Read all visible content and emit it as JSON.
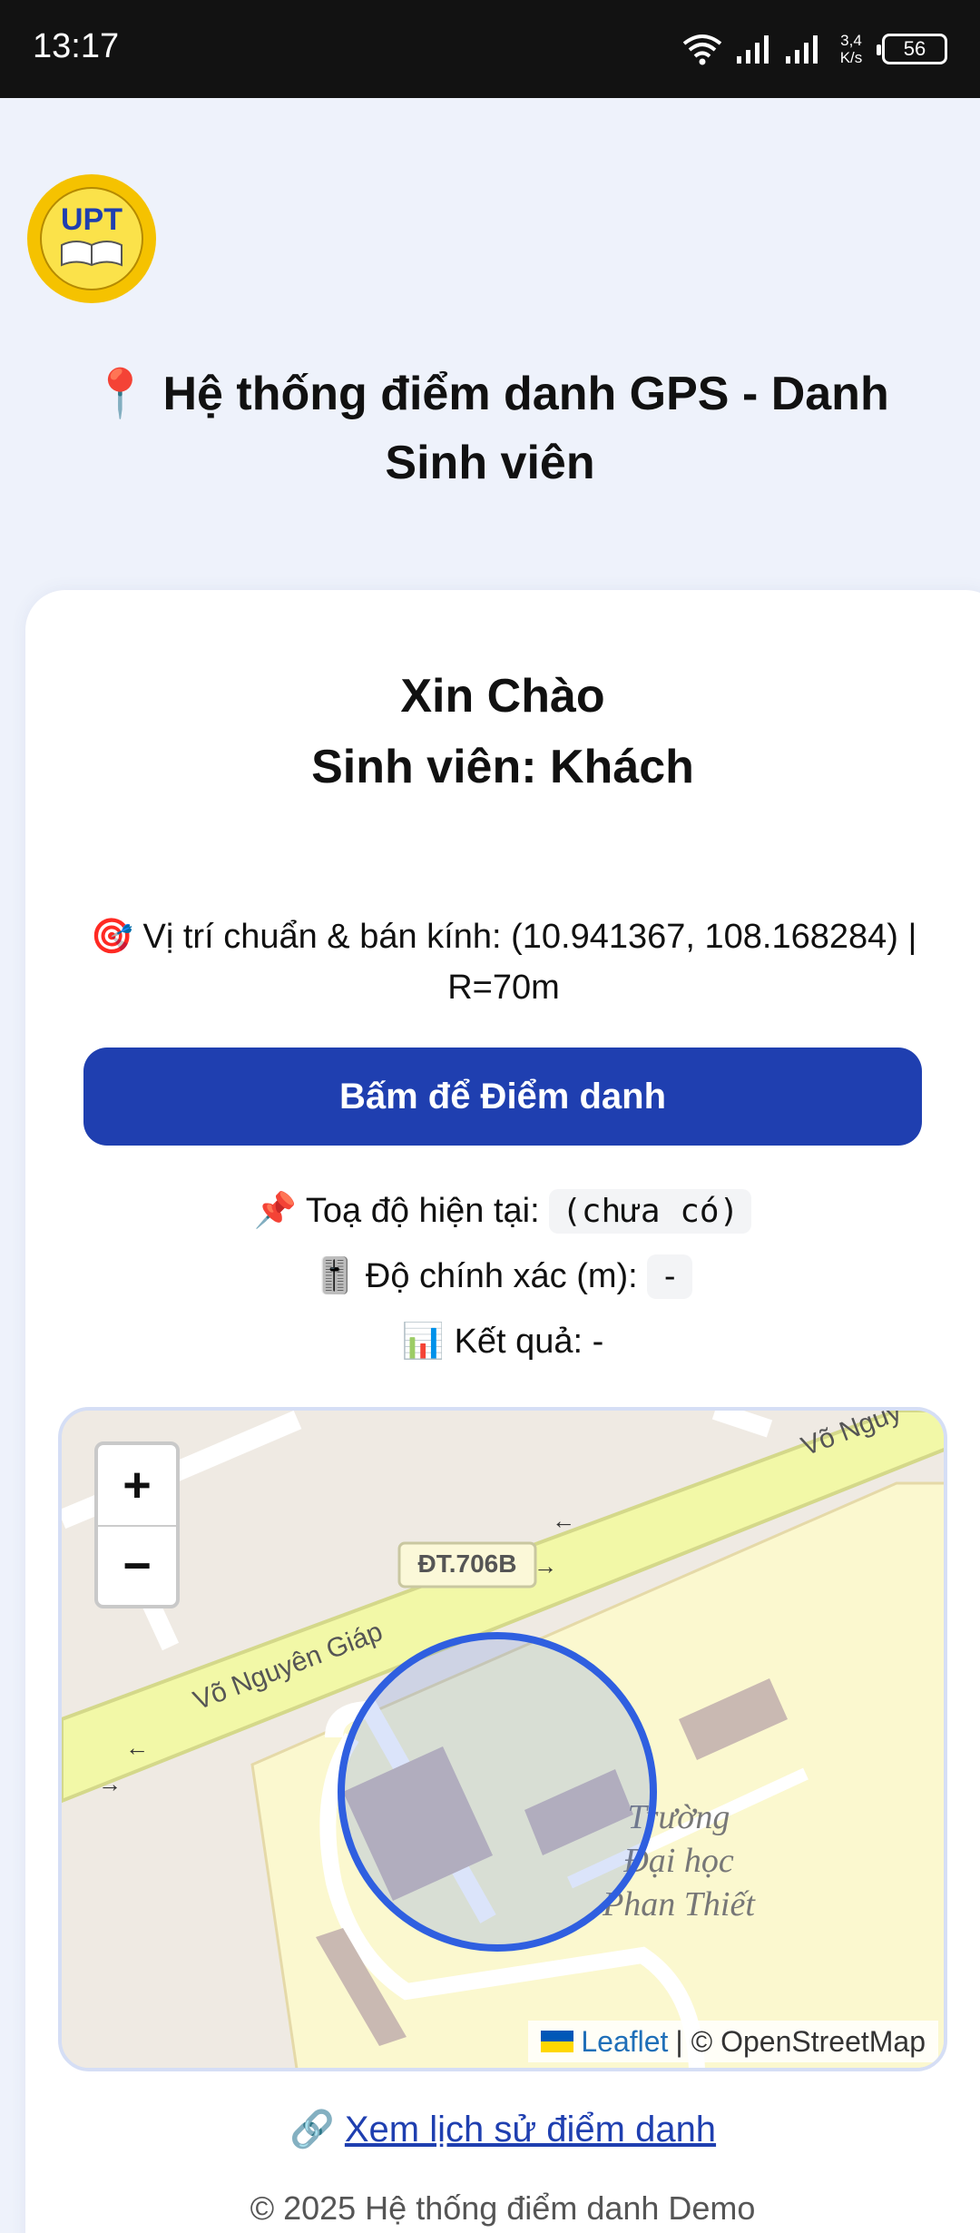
{
  "status_bar": {
    "time": "13:17",
    "net_speed_value": "3,4",
    "net_speed_unit": "K/s",
    "battery": "56"
  },
  "header": {
    "logo_text": "UPT",
    "title_icon": "📍",
    "title": "Hệ thống điểm danh GPS - Danh Sinh viên"
  },
  "greeting": {
    "line1": "Xin Chào",
    "line2": "Sinh viên: Khách"
  },
  "reference": {
    "icon": "🎯",
    "text": "Vị trí chuẩn & bán kính: (10.941367, 108.168284) | R=70m"
  },
  "checkin_button": "Bấm để Điểm danh",
  "coords": {
    "icon": "📌",
    "label": "Toạ độ hiện tại:",
    "value": "(chưa có)"
  },
  "accuracy": {
    "icon": "🎚️",
    "label": "Độ chính xác (m):",
    "value": "-"
  },
  "result": {
    "icon": "📊",
    "label": "Kết quả: -"
  },
  "map": {
    "zoom_in": "+",
    "zoom_out": "−",
    "road_badge": "ĐT.706B",
    "street_1": "Võ Nguyên Giáp",
    "street_2": "Võ Nguy",
    "poi_line1": "Trường",
    "poi_line2": "Đại học",
    "poi_line3": "Phan Thiết",
    "attribution_leaflet": "Leaflet",
    "attribution_rest": "| © OpenStreetMap",
    "circle_color": "#2f5fe0"
  },
  "history_link": {
    "icon": "🔗",
    "label": "Xem lịch sử điểm danh"
  },
  "footer": "© 2025 Hệ thống điểm danh Demo"
}
